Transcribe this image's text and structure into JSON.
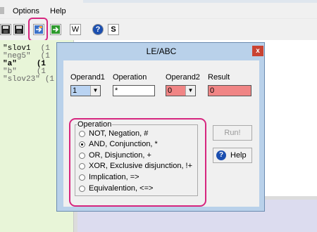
{
  "menubar": {
    "options": "Options",
    "help": "Help"
  },
  "toolbar": {
    "help_icon_glyph": "?",
    "s_icon_glyph": "S",
    "w_icon_glyph": "W"
  },
  "list": [
    {
      "name": "\"slov1",
      "value": "(1"
    },
    {
      "name": "\"neg5\"",
      "value": "(1"
    },
    {
      "name": "\"a\"",
      "value": "(1"
    },
    {
      "name": "\"b\"",
      "value": "(1"
    },
    {
      "name": "\"slov23\"",
      "value": "(1"
    }
  ],
  "dialog": {
    "title": "LE/ABC",
    "close_label": "x",
    "operand1": {
      "label": "Operand1",
      "value": "1"
    },
    "operation": {
      "label": "Operation",
      "value": "*"
    },
    "operand2": {
      "label": "Operand2",
      "value": "0"
    },
    "result": {
      "label": "Result",
      "value": "0"
    },
    "group_label": "Operation",
    "options": [
      {
        "label": "NOT, Negation, #",
        "selected": false
      },
      {
        "label": "AND, Conjunction, *",
        "selected": true
      },
      {
        "label": "OR, Disjunction, +",
        "selected": false
      },
      {
        "label": "XOR, Exclusive disjunction, !+",
        "selected": false
      },
      {
        "label": "Implication, =>",
        "selected": false
      },
      {
        "label": "Equivalention, <=>",
        "selected": false
      }
    ],
    "run_label": "Run!",
    "help_label": "Help"
  },
  "colors": {
    "highlight": "#d6267f",
    "operand1_bg": "#b9d3f2",
    "result_bg": "#f08585",
    "dialog_frame": "#b9d1ea",
    "left_pane": "#e8f5d8"
  }
}
